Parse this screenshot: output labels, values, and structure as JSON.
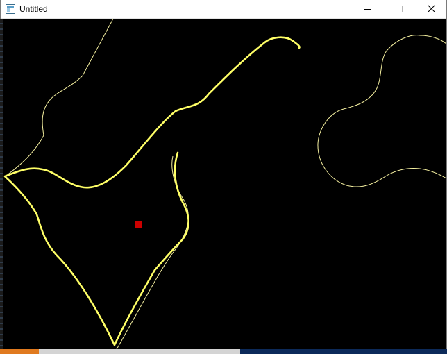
{
  "window": {
    "title": "Untitled",
    "icon": "app-window-icon",
    "controls": {
      "minimize_icon": "minimize-icon",
      "maximize_icon": "maximize-icon",
      "close_icon": "close-icon"
    }
  },
  "canvas": {
    "background": "#000000",
    "stroke_color": "#ffff66",
    "thin_stroke_color": "#f5f0a0",
    "marker_color": "#cc0000"
  }
}
